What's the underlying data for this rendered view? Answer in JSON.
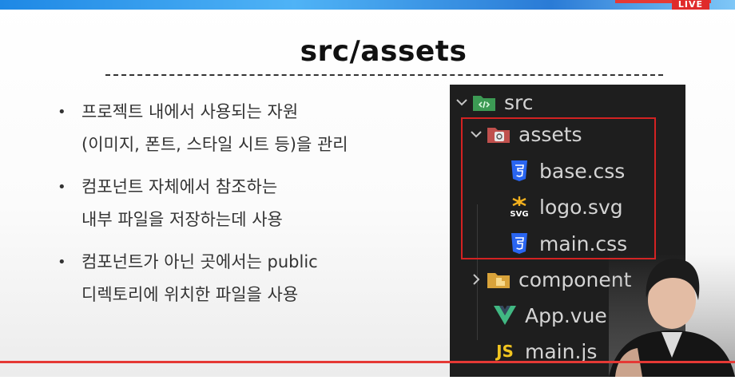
{
  "banner": {
    "live_label": "LIVE"
  },
  "slide": {
    "title": "src/assets",
    "bullets": [
      {
        "lines": [
          "프로젝트 내에서 사용되는 자원",
          "(이미지, 폰트, 스타일 시트 등)을 관리"
        ]
      },
      {
        "lines": [
          "컴포넌트 자체에서 참조하는",
          "내부 파일을 저장하는데 사용"
        ]
      },
      {
        "lines": [
          "컴포넌트가 아닌 곳에서는 public",
          "디렉토리에 위치한 파일을 사용"
        ]
      }
    ]
  },
  "explorer": {
    "items": [
      {
        "label": "src",
        "icon": "folder-src-icon"
      },
      {
        "label": "assets",
        "icon": "folder-assets-icon"
      },
      {
        "label": "base.css",
        "icon": "css3-icon"
      },
      {
        "label": "logo.svg",
        "icon": "svg-icon"
      },
      {
        "label": "main.css",
        "icon": "css3-icon"
      },
      {
        "label": "component",
        "icon": "folder-components-icon"
      },
      {
        "label": "App.vue",
        "icon": "vue-icon"
      },
      {
        "label": "main.js",
        "icon": "js-icon"
      }
    ],
    "svg_icon_text": "SVG",
    "js_icon_text": "JS"
  },
  "colors": {
    "highlight_border": "#d32222",
    "css_icon": "#2965f1",
    "vue_green": "#41b883",
    "js_yellow": "#f0c420",
    "folder_green": "#3c9a54"
  }
}
